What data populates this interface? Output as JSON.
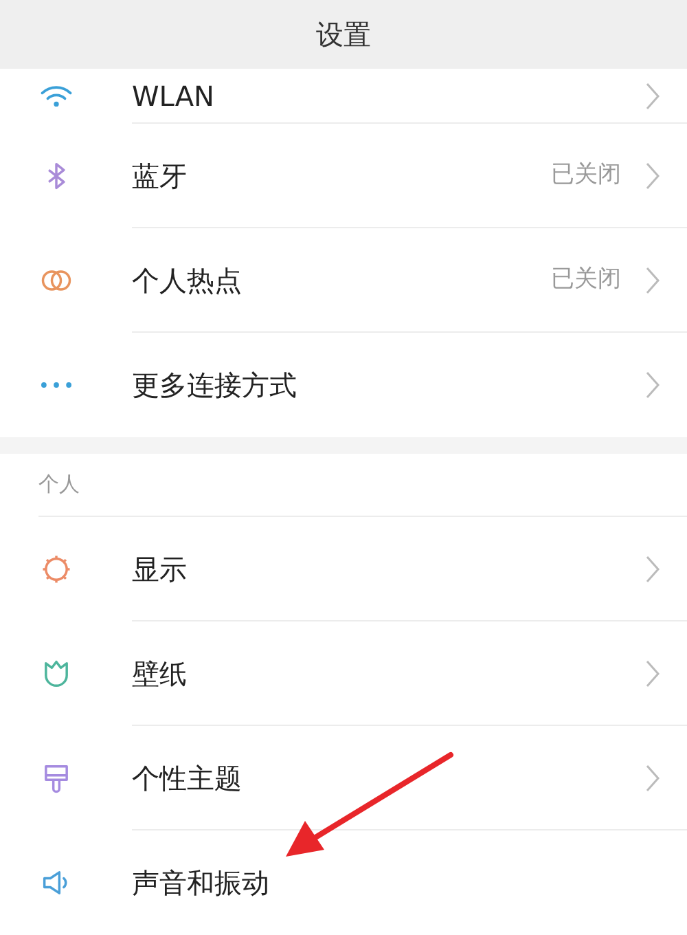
{
  "header": {
    "title": "设置"
  },
  "sections": [
    {
      "items": [
        {
          "label": "WLAN",
          "chevron": true
        },
        {
          "label": "蓝牙",
          "value": "已关闭",
          "chevron": true
        },
        {
          "label": "个人热点",
          "value": "已关闭",
          "chevron": true
        },
        {
          "label": "更多连接方式",
          "chevron": true
        }
      ]
    },
    {
      "title": "个人",
      "items": [
        {
          "label": "显示",
          "chevron": true
        },
        {
          "label": "壁纸",
          "chevron": true
        },
        {
          "label": "个性主题",
          "chevron": true
        },
        {
          "label": "声音和振动",
          "chevron": false
        }
      ]
    }
  ],
  "annotation": {
    "kind": "arrow"
  }
}
